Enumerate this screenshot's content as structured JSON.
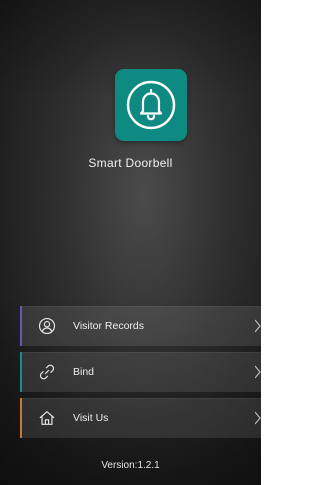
{
  "app": {
    "name": "Smart Doorbell",
    "tile_color": "#0f8a83",
    "icon": "bell-icon"
  },
  "menu": {
    "items": [
      {
        "label": "Visitor Records",
        "icon": "user-circle-icon",
        "accent": "#6a55b8"
      },
      {
        "label": "Bind",
        "icon": "link-icon",
        "accent": "#168f86"
      },
      {
        "label": "Visit Us",
        "icon": "home-icon",
        "accent": "#c97a2c"
      }
    ]
  },
  "footer": {
    "version": "Version:1.2.1"
  }
}
